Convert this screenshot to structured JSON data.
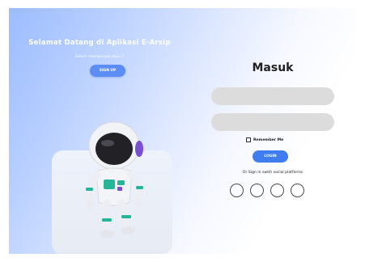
{
  "welcome": {
    "title": "Selamat Datang di Aplikasi E-Arsip",
    "subtitle": "Belum mempunyai akun ?",
    "signup_label": "SIGN UP"
  },
  "login": {
    "title": "Masuk",
    "username": {
      "value": "",
      "placeholder": ""
    },
    "password": {
      "value": "",
      "placeholder": ""
    },
    "remember_label": "Remember Me",
    "remember_checked": false,
    "login_label": "LOGIN",
    "social_text": "Or Sign in swith social platforms",
    "social_buttons": [
      {
        "icon": "social-icon"
      },
      {
        "icon": "social-icon"
      },
      {
        "icon": "social-icon"
      },
      {
        "icon": "social-icon"
      }
    ]
  },
  "colors": {
    "accent": "#3f7cf0",
    "signup": "#5b8df5",
    "field": "#dcdcdc",
    "gradient_start": "#9cbcff"
  },
  "illustration": {
    "icon": "astronaut-robot-icon"
  }
}
